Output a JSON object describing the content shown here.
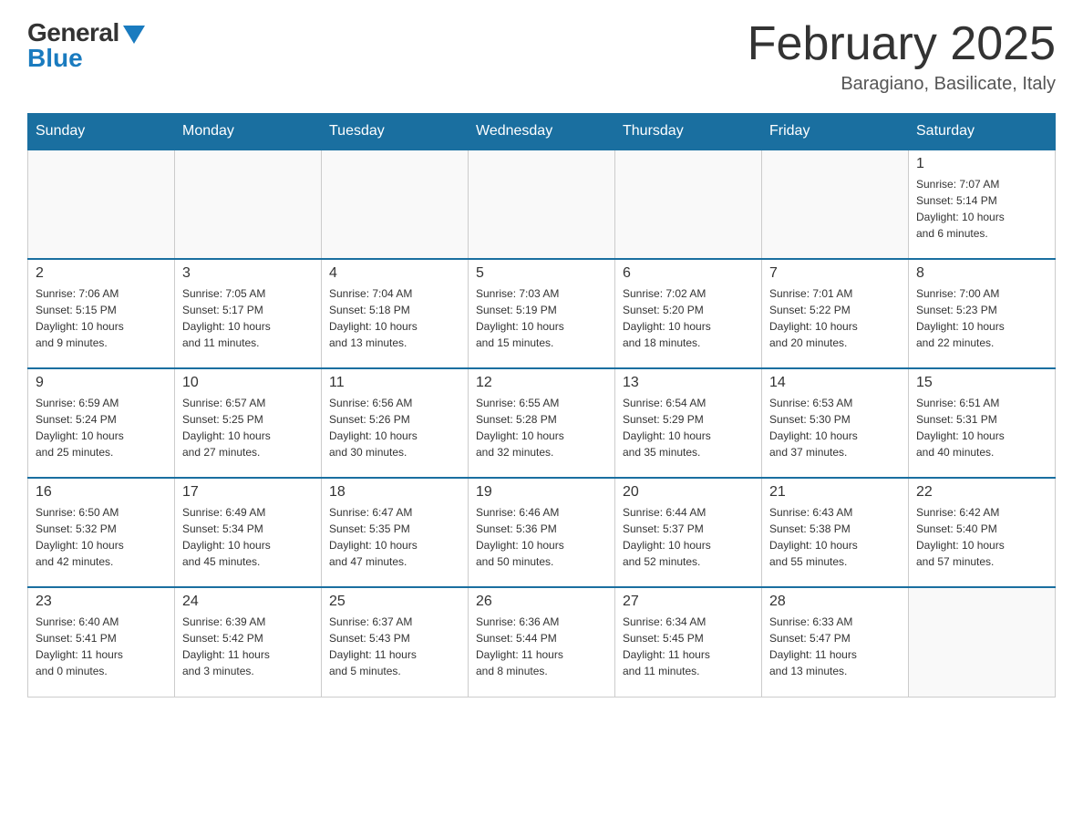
{
  "header": {
    "logo_general": "General",
    "logo_blue": "Blue",
    "title": "February 2025",
    "subtitle": "Baragiano, Basilicate, Italy"
  },
  "weekdays": [
    "Sunday",
    "Monday",
    "Tuesday",
    "Wednesday",
    "Thursday",
    "Friday",
    "Saturday"
  ],
  "weeks": [
    [
      {
        "day": "",
        "info": ""
      },
      {
        "day": "",
        "info": ""
      },
      {
        "day": "",
        "info": ""
      },
      {
        "day": "",
        "info": ""
      },
      {
        "day": "",
        "info": ""
      },
      {
        "day": "",
        "info": ""
      },
      {
        "day": "1",
        "info": "Sunrise: 7:07 AM\nSunset: 5:14 PM\nDaylight: 10 hours\nand 6 minutes."
      }
    ],
    [
      {
        "day": "2",
        "info": "Sunrise: 7:06 AM\nSunset: 5:15 PM\nDaylight: 10 hours\nand 9 minutes."
      },
      {
        "day": "3",
        "info": "Sunrise: 7:05 AM\nSunset: 5:17 PM\nDaylight: 10 hours\nand 11 minutes."
      },
      {
        "day": "4",
        "info": "Sunrise: 7:04 AM\nSunset: 5:18 PM\nDaylight: 10 hours\nand 13 minutes."
      },
      {
        "day": "5",
        "info": "Sunrise: 7:03 AM\nSunset: 5:19 PM\nDaylight: 10 hours\nand 15 minutes."
      },
      {
        "day": "6",
        "info": "Sunrise: 7:02 AM\nSunset: 5:20 PM\nDaylight: 10 hours\nand 18 minutes."
      },
      {
        "day": "7",
        "info": "Sunrise: 7:01 AM\nSunset: 5:22 PM\nDaylight: 10 hours\nand 20 minutes."
      },
      {
        "day": "8",
        "info": "Sunrise: 7:00 AM\nSunset: 5:23 PM\nDaylight: 10 hours\nand 22 minutes."
      }
    ],
    [
      {
        "day": "9",
        "info": "Sunrise: 6:59 AM\nSunset: 5:24 PM\nDaylight: 10 hours\nand 25 minutes."
      },
      {
        "day": "10",
        "info": "Sunrise: 6:57 AM\nSunset: 5:25 PM\nDaylight: 10 hours\nand 27 minutes."
      },
      {
        "day": "11",
        "info": "Sunrise: 6:56 AM\nSunset: 5:26 PM\nDaylight: 10 hours\nand 30 minutes."
      },
      {
        "day": "12",
        "info": "Sunrise: 6:55 AM\nSunset: 5:28 PM\nDaylight: 10 hours\nand 32 minutes."
      },
      {
        "day": "13",
        "info": "Sunrise: 6:54 AM\nSunset: 5:29 PM\nDaylight: 10 hours\nand 35 minutes."
      },
      {
        "day": "14",
        "info": "Sunrise: 6:53 AM\nSunset: 5:30 PM\nDaylight: 10 hours\nand 37 minutes."
      },
      {
        "day": "15",
        "info": "Sunrise: 6:51 AM\nSunset: 5:31 PM\nDaylight: 10 hours\nand 40 minutes."
      }
    ],
    [
      {
        "day": "16",
        "info": "Sunrise: 6:50 AM\nSunset: 5:32 PM\nDaylight: 10 hours\nand 42 minutes."
      },
      {
        "day": "17",
        "info": "Sunrise: 6:49 AM\nSunset: 5:34 PM\nDaylight: 10 hours\nand 45 minutes."
      },
      {
        "day": "18",
        "info": "Sunrise: 6:47 AM\nSunset: 5:35 PM\nDaylight: 10 hours\nand 47 minutes."
      },
      {
        "day": "19",
        "info": "Sunrise: 6:46 AM\nSunset: 5:36 PM\nDaylight: 10 hours\nand 50 minutes."
      },
      {
        "day": "20",
        "info": "Sunrise: 6:44 AM\nSunset: 5:37 PM\nDaylight: 10 hours\nand 52 minutes."
      },
      {
        "day": "21",
        "info": "Sunrise: 6:43 AM\nSunset: 5:38 PM\nDaylight: 10 hours\nand 55 minutes."
      },
      {
        "day": "22",
        "info": "Sunrise: 6:42 AM\nSunset: 5:40 PM\nDaylight: 10 hours\nand 57 minutes."
      }
    ],
    [
      {
        "day": "23",
        "info": "Sunrise: 6:40 AM\nSunset: 5:41 PM\nDaylight: 11 hours\nand 0 minutes."
      },
      {
        "day": "24",
        "info": "Sunrise: 6:39 AM\nSunset: 5:42 PM\nDaylight: 11 hours\nand 3 minutes."
      },
      {
        "day": "25",
        "info": "Sunrise: 6:37 AM\nSunset: 5:43 PM\nDaylight: 11 hours\nand 5 minutes."
      },
      {
        "day": "26",
        "info": "Sunrise: 6:36 AM\nSunset: 5:44 PM\nDaylight: 11 hours\nand 8 minutes."
      },
      {
        "day": "27",
        "info": "Sunrise: 6:34 AM\nSunset: 5:45 PM\nDaylight: 11 hours\nand 11 minutes."
      },
      {
        "day": "28",
        "info": "Sunrise: 6:33 AM\nSunset: 5:47 PM\nDaylight: 11 hours\nand 13 minutes."
      },
      {
        "day": "",
        "info": ""
      }
    ]
  ]
}
